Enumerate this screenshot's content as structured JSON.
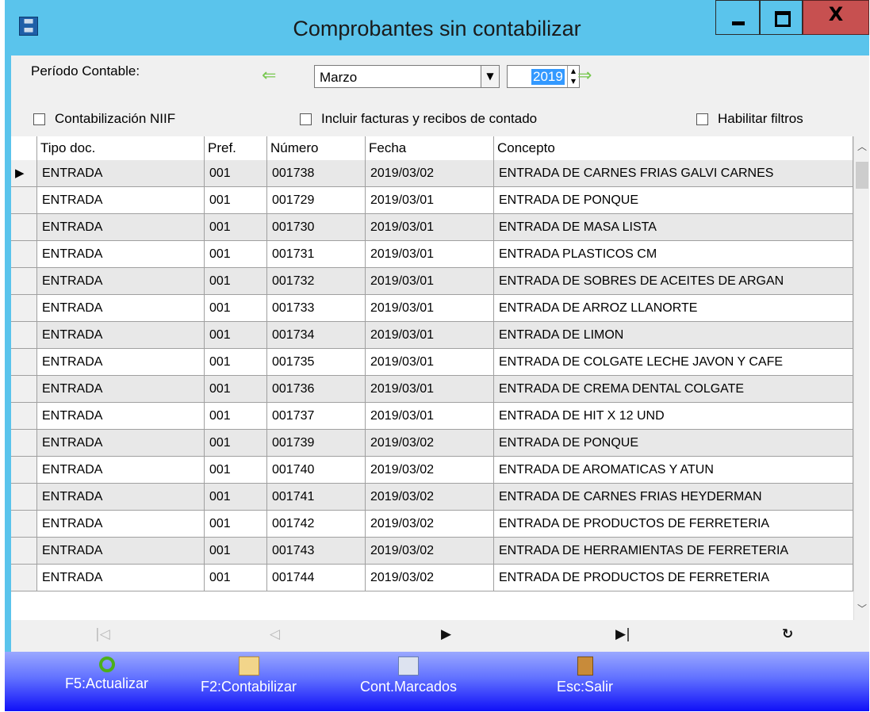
{
  "window": {
    "title": "Comprobantes sin contabilizar",
    "app_icon": "app-grid-icon",
    "minimize_icon": "minimize-icon",
    "maximize_icon": "maximize-icon",
    "close_label": "X"
  },
  "period": {
    "label": "Período Contable:",
    "month": "Marzo",
    "year": "2019",
    "prev_icon": "arrow-left-icon",
    "next_icon": "arrow-right-icon"
  },
  "options": {
    "niif": "Contabilización NIIF",
    "cash": "Incluir facturas y recibos de contado",
    "filters": "Habilitar filtros"
  },
  "grid": {
    "headers": [
      "Tipo doc.",
      "Pref.",
      "Número",
      "Fecha",
      "Concepto"
    ],
    "rows": [
      [
        "ENTRADA",
        "001",
        "001738",
        "2019/03/02",
        "ENTRADA DE CARNES FRIAS GALVI CARNES"
      ],
      [
        "ENTRADA",
        "001",
        "001729",
        "2019/03/01",
        "ENTRADA DE PONQUE"
      ],
      [
        "ENTRADA",
        "001",
        "001730",
        "2019/03/01",
        "ENTRADA DE MASA LISTA"
      ],
      [
        "ENTRADA",
        "001",
        "001731",
        "2019/03/01",
        "ENTRADA PLASTICOS CM"
      ],
      [
        "ENTRADA",
        "001",
        "001732",
        "2019/03/01",
        "ENTRADA DE SOBRES DE ACEITES DE ARGAN"
      ],
      [
        "ENTRADA",
        "001",
        "001733",
        "2019/03/01",
        "ENTRADA DE ARROZ LLANORTE"
      ],
      [
        "ENTRADA",
        "001",
        "001734",
        "2019/03/01",
        "ENTRADA DE LIMON"
      ],
      [
        "ENTRADA",
        "001",
        "001735",
        "2019/03/01",
        "ENTRADA DE  COLGATE LECHE JAVON Y CAFE"
      ],
      [
        "ENTRADA",
        "001",
        "001736",
        "2019/03/01",
        "ENTRADA DE CREMA DENTAL COLGATE"
      ],
      [
        "ENTRADA",
        "001",
        "001737",
        "2019/03/01",
        "ENTRADA DE HIT X 12 UND"
      ],
      [
        "ENTRADA",
        "001",
        "001739",
        "2019/03/02",
        "ENTRADA DE PONQUE"
      ],
      [
        "ENTRADA",
        "001",
        "001740",
        "2019/03/02",
        "ENTRADA DE AROMATICAS Y ATUN"
      ],
      [
        "ENTRADA",
        "001",
        "001741",
        "2019/03/02",
        "ENTRADA DE CARNES FRIAS HEYDERMAN"
      ],
      [
        "ENTRADA",
        "001",
        "001742",
        "2019/03/02",
        "ENTRADA DE PRODUCTOS DE FERRETERIA"
      ],
      [
        "ENTRADA",
        "001",
        "001743",
        "2019/03/02",
        "ENTRADA DE HERRAMIENTAS DE FERRETERIA"
      ],
      [
        "ENTRADA",
        "001",
        "001744",
        "2019/03/02",
        "ENTRADA DE PRODUCTOS DE FERRETERIA"
      ]
    ],
    "selected_row": 0
  },
  "navigator": {
    "first_icon": "first-record-icon",
    "prev_icon": "prev-record-icon",
    "next_icon": "next-record-icon",
    "last_icon": "last-record-icon",
    "refresh_icon": "refresh-icon"
  },
  "toolbar": {
    "refresh": "F5:Actualizar",
    "post": "F2:Contabilizar",
    "marked": "Cont.Marcados",
    "exit": "Esc:Salir"
  }
}
